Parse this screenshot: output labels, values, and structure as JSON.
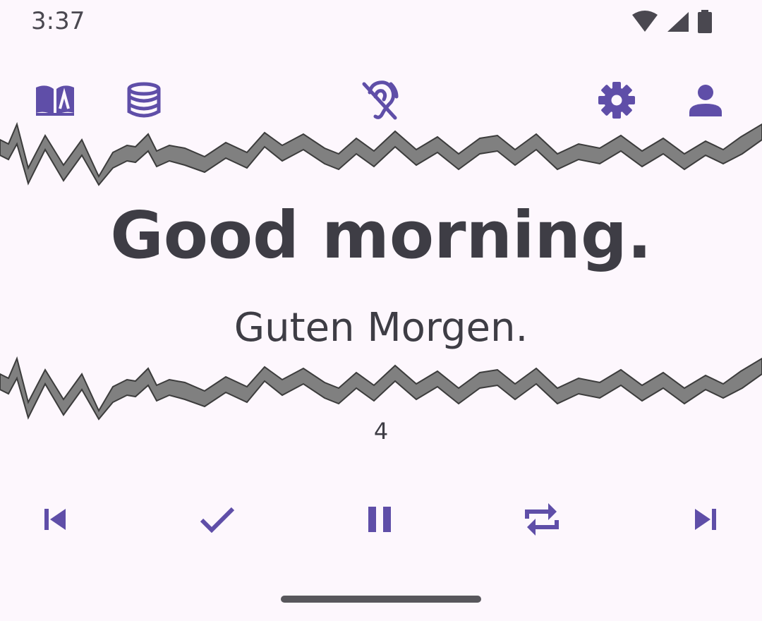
{
  "status_bar": {
    "time": "3:37",
    "icons": [
      "wifi-icon",
      "cellular-signal-icon",
      "battery-icon"
    ]
  },
  "toolbar": {
    "left": [
      "open-book-icon",
      "database-icon"
    ],
    "center": "hearing-disabled-icon",
    "right": [
      "settings-gear-icon",
      "person-icon"
    ]
  },
  "card": {
    "phrase": "Good morning.",
    "translation": "Guten Morgen.",
    "counter": "4"
  },
  "controls": [
    "skip-previous-icon",
    "check-icon",
    "pause-icon",
    "repeat-icon",
    "skip-next-icon"
  ],
  "colors": {
    "background": "#fdf7fd",
    "accent": "#5f4ea8",
    "text": "#3e3d45",
    "wave_fill": "#808080",
    "wave_stroke": "#3c3c3c"
  }
}
